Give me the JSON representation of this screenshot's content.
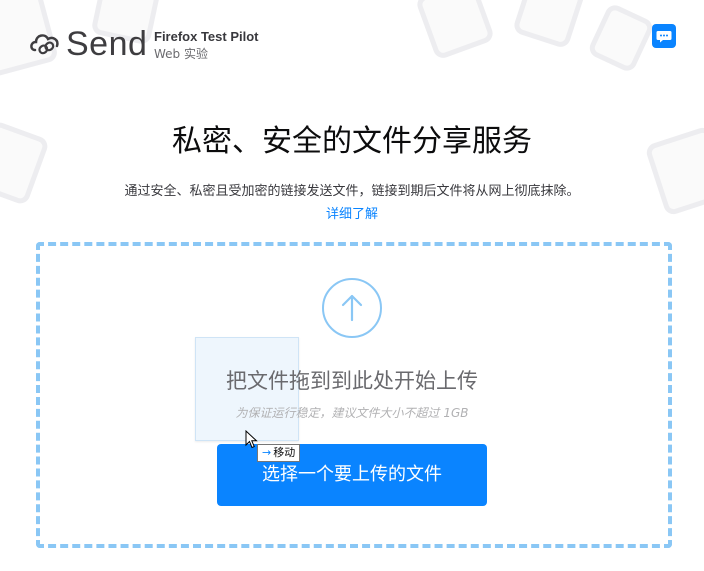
{
  "header": {
    "brand": "Send",
    "pilot_title": "Firefox Test Pilot",
    "pilot_subtitle": "Web 实验"
  },
  "hero": {
    "title": "私密、安全的文件分享服务",
    "description": "通过安全、私密且受加密的链接发送文件，链接到期后文件将从网上彻底抹除。",
    "learn_more": "详细了解"
  },
  "upload": {
    "drop_text": "把文件拖到到此处开始上传",
    "drop_hint": "为保证运行稳定，建议文件大小不超过 1GB",
    "select_button": "选择一个要上传的文件",
    "drag_action": "移动"
  },
  "colors": {
    "accent": "#0a84ff",
    "dashed_border": "#8ac7f5"
  },
  "icons": [
    "cloud-link-icon",
    "feedback-chat-icon",
    "upload-arrow-icon",
    "mouse-cursor-icon",
    "drag-arrow-icon"
  ]
}
